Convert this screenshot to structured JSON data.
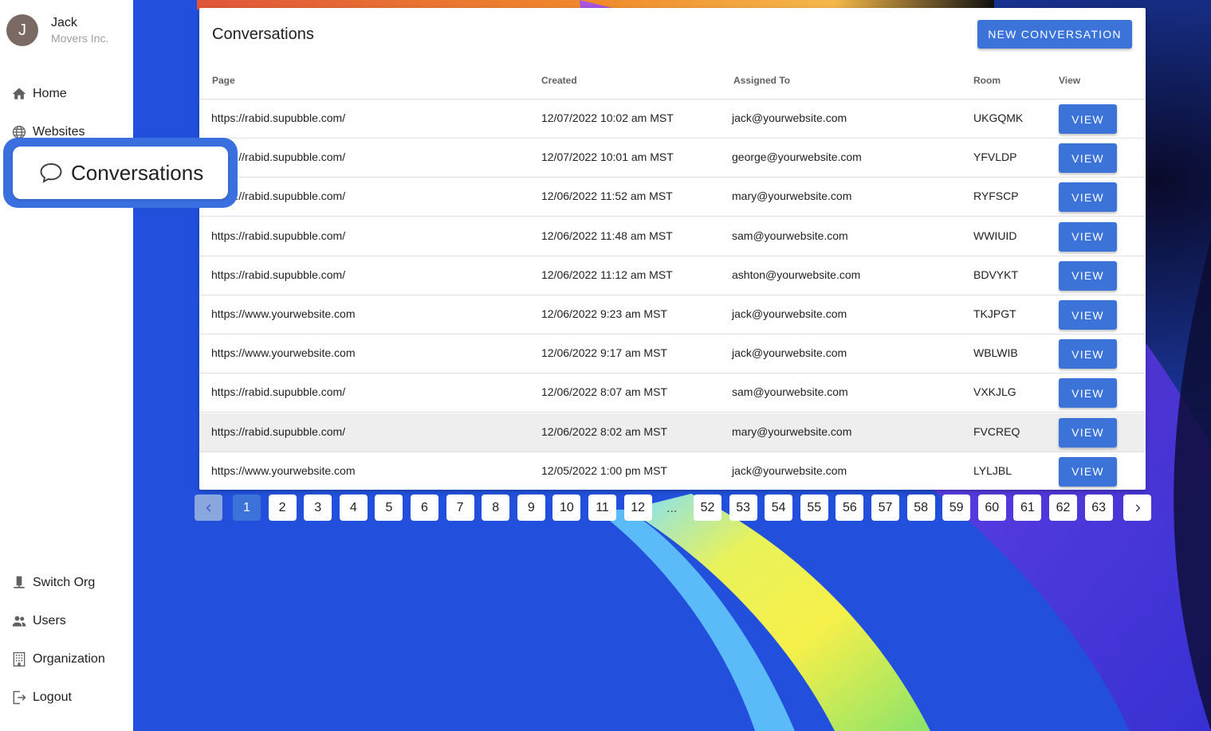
{
  "sidebar": {
    "avatar_letter": "J",
    "user_name": "Jack",
    "org_name": "Movers Inc.",
    "nav_top": [
      {
        "label": "Home",
        "icon": "home-icon"
      },
      {
        "label": "Websites",
        "icon": "globe-icon"
      }
    ],
    "highlight": {
      "label": "Conversations",
      "icon": "chat-bubble-icon"
    },
    "nav_bottom": [
      {
        "label": "Switch Org",
        "icon": "switch-org-icon"
      },
      {
        "label": "Users",
        "icon": "users-icon"
      },
      {
        "label": "Organization",
        "icon": "building-icon"
      },
      {
        "label": "Logout",
        "icon": "logout-icon"
      }
    ]
  },
  "card": {
    "title": "Conversations",
    "new_button": "NEW CONVERSATION",
    "columns": [
      "Page",
      "Created",
      "Assigned To",
      "Room",
      "View"
    ],
    "view_label": "VIEW",
    "rows": [
      {
        "page": "https://rabid.supubble.com/",
        "created": "12/07/2022 10:02 am MST",
        "assigned": "jack@yourwebsite.com",
        "room": "UKGQMK"
      },
      {
        "page": "https://rabid.supubble.com/",
        "created": "12/07/2022 10:01 am MST",
        "assigned": "george@yourwebsite.com",
        "room": "YFVLDP"
      },
      {
        "page": "https://rabid.supubble.com/",
        "created": "12/06/2022 11:52 am MST",
        "assigned": "mary@yourwebsite.com",
        "room": "RYFSCP"
      },
      {
        "page": "https://rabid.supubble.com/",
        "created": "12/06/2022 11:48 am MST",
        "assigned": "sam@yourwebsite.com",
        "room": "WWIUID"
      },
      {
        "page": "https://rabid.supubble.com/",
        "created": "12/06/2022 11:12 am MST",
        "assigned": "ashton@yourwebsite.com",
        "room": "BDVYKT"
      },
      {
        "page": "https://www.yourwebsite.com",
        "created": "12/06/2022 9:23 am MST",
        "assigned": "jack@yourwebsite.com",
        "room": "TKJPGT"
      },
      {
        "page": "https://www.yourwebsite.com",
        "created": "12/06/2022 9:17 am MST",
        "assigned": "jack@yourwebsite.com",
        "room": "WBLWIB"
      },
      {
        "page": "https://rabid.supubble.com/",
        "created": "12/06/2022 8:07 am MST",
        "assigned": "sam@yourwebsite.com",
        "room": "VXKJLG"
      },
      {
        "page": "https://rabid.supubble.com/",
        "created": "12/06/2022 8:02 am MST",
        "assigned": "mary@yourwebsite.com",
        "room": "FVCREQ"
      },
      {
        "page": "https://www.yourwebsite.com",
        "created": "12/05/2022 1:00 pm MST",
        "assigned": "jack@yourwebsite.com",
        "room": "LYLJBL"
      }
    ],
    "highlighted_row": 8
  },
  "pagination": {
    "current": "1",
    "pages_start": [
      "1",
      "2",
      "3",
      "4",
      "5",
      "6",
      "7",
      "8",
      "9",
      "10",
      "11",
      "12"
    ],
    "ellipsis": "...",
    "pages_end": [
      "52",
      "53",
      "54",
      "55",
      "56",
      "57",
      "58",
      "59",
      "60",
      "61",
      "62",
      "63"
    ]
  },
  "colors": {
    "accent": "#3b73d9",
    "callout": "#3a6fe0",
    "background_blue": "#1f4bd8"
  }
}
